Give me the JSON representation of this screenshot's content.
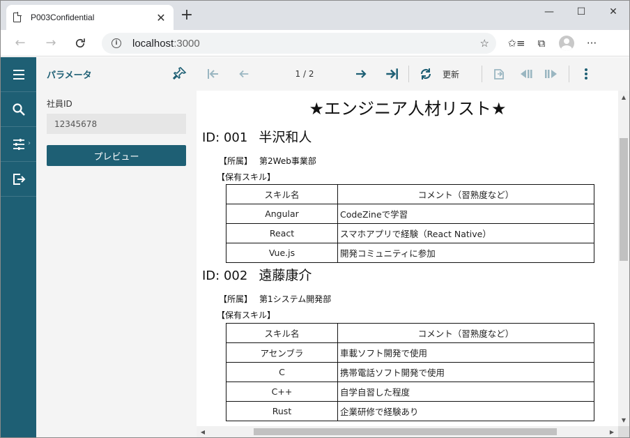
{
  "browser": {
    "tab_title": "P003Confidential",
    "url_host": "localhost",
    "url_port": ":3000"
  },
  "panel": {
    "title": "パラメータ",
    "param_label": "社員ID",
    "param_value": "12345678",
    "preview_label": "プレビュー"
  },
  "viewer": {
    "page_indicator": "1 / 2",
    "refresh_label": "更新"
  },
  "report": {
    "title": "★エンジニア人材リスト★",
    "table_headers": [
      "スキル名",
      "コメント（習熟度など）"
    ],
    "employees": [
      {
        "id_label": "ID: 001",
        "name": "半沢和人",
        "dept_label": "【所属】",
        "dept": "第2Web事業部",
        "skills_label": "【保有スキル】",
        "skills": [
          {
            "skill": "Angular",
            "comment": "CodeZineで学習"
          },
          {
            "skill": "React",
            "comment": "スマホアプリで経験（React Native）"
          },
          {
            "skill": "Vue.js",
            "comment": "開発コミュニティに参加"
          }
        ]
      },
      {
        "id_label": "ID: 002",
        "name": "遠藤康介",
        "dept_label": "【所属】",
        "dept": "第1システム開発部",
        "skills_label": "【保有スキル】",
        "skills": [
          {
            "skill": "アセンブラ",
            "comment": "車載ソフト開発で使用"
          },
          {
            "skill": "C",
            "comment": "携帯電話ソフト開発で使用"
          },
          {
            "skill": "C++",
            "comment": "自学自習した程度"
          },
          {
            "skill": "Rust",
            "comment": "企業研修で経験あり"
          }
        ]
      }
    ]
  }
}
